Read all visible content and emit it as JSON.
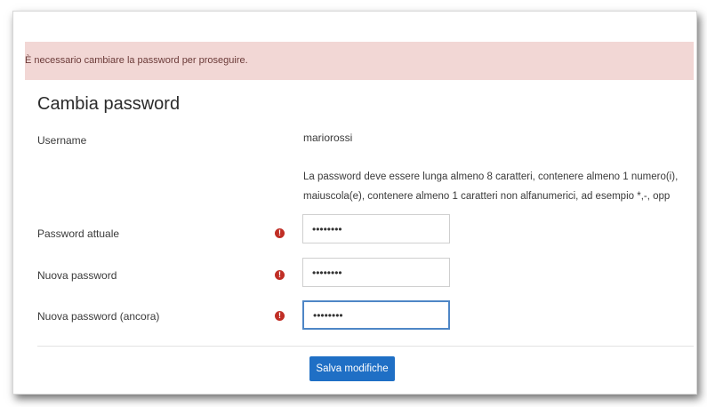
{
  "alert": {
    "text": "È necessario cambiare la password per proseguire."
  },
  "form": {
    "title": "Cambia password",
    "username": {
      "label": "Username",
      "value": "mariorossi"
    },
    "hint_lines": [
      "La password deve essere lunga almeno 8 caratteri, contenere almeno 1 numero(i),",
      "maiuscola(e), contenere almeno 1 caratteri non alfanumerici, ad esempio *,-, opp"
    ],
    "fields": [
      {
        "label": "Password attuale",
        "value": "Passw0rd",
        "required_icon": "!"
      },
      {
        "label": "Nuova password",
        "value": "Passw0rd",
        "required_icon": "!"
      },
      {
        "label": "Nuova password (ancora)",
        "value": "Passw0rd",
        "required_icon": "!"
      }
    ],
    "submit_label": "Salva modifiche"
  },
  "colors": {
    "alert_bg": "#f2d7d5",
    "required": "#c02e25",
    "primary": "#1f6fc5",
    "focus": "#4e86c6"
  }
}
